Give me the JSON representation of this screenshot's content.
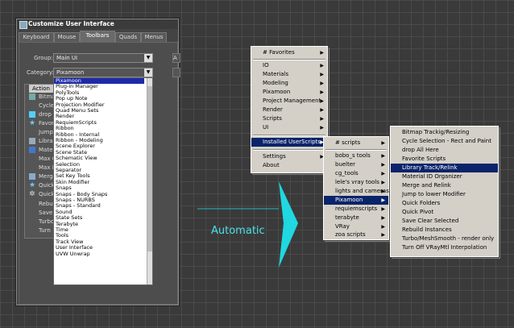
{
  "dialog": {
    "title": "Customize User Interface",
    "tabs": [
      "Keyboard",
      "Mouse",
      "Toolbars",
      "Quads",
      "Menus"
    ],
    "group_label": "Group:",
    "group_value": "Main UI",
    "category_label": "Category:",
    "category_value": "Pixamoon",
    "actions_header": "Action",
    "action_items": [
      "Bitmap",
      "Cycle",
      "drop",
      "Favori",
      "Jump",
      "Librar",
      "Mater",
      "Max C",
      "Max R",
      "Merge",
      "Quick",
      "Quick",
      "Rebuil",
      "Save",
      "Turbo",
      "Turn"
    ],
    "dropdown_items": [
      "Pixamoon",
      "Plug-in Manager",
      "PolyTools",
      "Pop up Note",
      "Projection Modifier",
      "Quad Menu Sets",
      "Render",
      "RequiemScripts",
      "Ribbon",
      "Ribbon - Internal",
      "Ribbon - Modeling",
      "Scene Explorer",
      "Scene State",
      "Schematic View",
      "Selection",
      "Separator",
      "Set Key Tools",
      "Skin Modifier",
      "Snaps",
      "Snaps - Body Snaps",
      "Snaps - NURBS",
      "Snaps - Standard",
      "Sound",
      "State Sets",
      "Terabyte",
      "Time",
      "Tools",
      "Track View",
      "User Interface",
      "UVW Unwrap"
    ],
    "right_partial": "A"
  },
  "annotation": {
    "label": "Automatic",
    "color": "#1fd8e0"
  },
  "menu1": {
    "items": [
      {
        "label": "# Favorites",
        "sub": "▶"
      },
      {
        "label": "IO",
        "sub": "▶"
      },
      {
        "label": "Materials",
        "sub": "▶"
      },
      {
        "label": "Modeling",
        "sub": "▶"
      },
      {
        "label": "Pixamoon",
        "sub": "▶"
      },
      {
        "label": "Project Management",
        "sub": "▶"
      },
      {
        "label": "Render",
        "sub": "▶"
      },
      {
        "label": "Scripts",
        "sub": "▶"
      },
      {
        "label": "UI",
        "sub": "▶"
      },
      {
        "label": "Installed UserScripts",
        "sub": "▶"
      },
      {
        "label": "Settings",
        "sub": "▶"
      },
      {
        "label": "About",
        "sub": ""
      }
    ]
  },
  "menu2": {
    "items": [
      {
        "label": "# scripts",
        "sub": "▶"
      },
      {
        "label": "bobo_s tools",
        "sub": "▶"
      },
      {
        "label": "buelter",
        "sub": "▶"
      },
      {
        "label": "cg_tools",
        "sub": "▶"
      },
      {
        "label": "lele's vray tools",
        "sub": "▶"
      },
      {
        "label": "lights and cameras",
        "sub": "▶"
      },
      {
        "label": "Pixamoon",
        "sub": "▶"
      },
      {
        "label": "requiemscripts",
        "sub": "▶"
      },
      {
        "label": "terabyte",
        "sub": "▶"
      },
      {
        "label": "VRay",
        "sub": "▶"
      },
      {
        "label": "zoa scripts",
        "sub": "▶"
      }
    ]
  },
  "menu3": {
    "items": [
      "Bitmap Trackig/Resizing",
      "Cycle Selection - Rect and Paint",
      "drop All Here",
      "Favorite Scripts",
      "Library Track/Relink",
      "Material ID Organizer",
      "Merge and Relink",
      "Jump to lower Modifier",
      "Quick Folders",
      "Quick Pivot",
      "Save Clear Selected",
      "Rebuild Instances",
      "Turbo/MeshSmooth - render only",
      "Turn Off VRayMtl Interpolation"
    ]
  }
}
